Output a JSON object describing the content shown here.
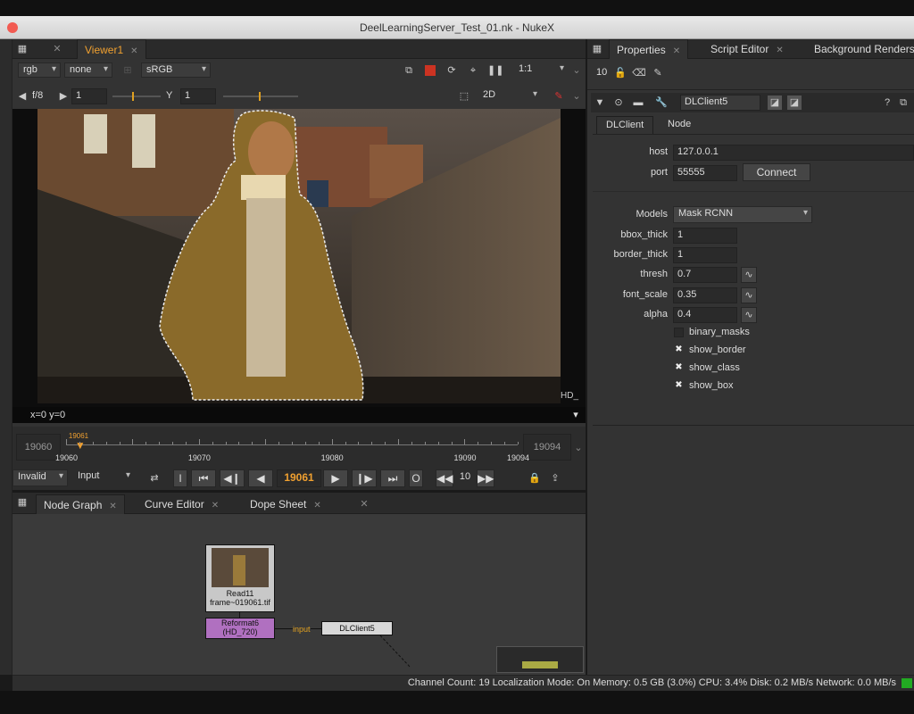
{
  "window": {
    "title": "DeelLearningServer_Test_01.nk - NukeX"
  },
  "viewer": {
    "tab_label": "Viewer1",
    "channels": "rgb",
    "alpha": "none",
    "colorspace": "sRGB",
    "zoom": "1:1",
    "fstop": "f/8",
    "gain": "1",
    "gamma_label": "Y",
    "gamma": "1",
    "mode": "2D",
    "format_label": "HD_",
    "coords": "x=0 y=0"
  },
  "timeline": {
    "start": "19060",
    "end": "19094",
    "current_marker": "19061",
    "ticks": [
      "19060",
      "19070",
      "19080",
      "19090",
      "19094"
    ],
    "cache_mode": "Invalid",
    "input_mode": "Input",
    "current_frame": "19061",
    "step": "10",
    "play_range": {
      "min": 19060,
      "max": 19094,
      "current": 19061
    }
  },
  "bottom_tabs": [
    "Node Graph",
    "Curve Editor",
    "Dope Sheet"
  ],
  "nodes": {
    "read": {
      "name": "Read11",
      "file": "frame~019061.tif"
    },
    "reformat": {
      "name": "Reformat6",
      "format": "(HD_720)"
    },
    "dl": {
      "name": "DLClient5"
    },
    "edge_label": "input"
  },
  "properties": {
    "tabs": [
      "Properties",
      "Script Editor",
      "Background Renders"
    ],
    "max_panels": "10",
    "node_name": "DLClient5",
    "subtabs": [
      "DLClient",
      "Node"
    ],
    "host_label": "host",
    "host": "127.0.0.1",
    "port_label": "port",
    "port": "55555",
    "connect_label": "Connect",
    "models_label": "Models",
    "model": "Mask RCNN",
    "knobs": [
      {
        "label": "bbox_thick",
        "value": "1"
      },
      {
        "label": "border_thick",
        "value": "1"
      },
      {
        "label": "thresh",
        "value": "0.7"
      },
      {
        "label": "font_scale",
        "value": "0.35"
      },
      {
        "label": "alpha",
        "value": "0.4"
      }
    ],
    "checks": [
      {
        "label": "binary_masks",
        "checked": false
      },
      {
        "label": "show_border",
        "checked": true
      },
      {
        "label": "show_class",
        "checked": true
      },
      {
        "label": "show_box",
        "checked": true
      }
    ]
  },
  "status": "Channel Count: 19 Localization Mode: On Memory: 0.5 GB (3.0%) CPU: 3.4% Disk: 0.2 MB/s Network: 0.0 MB/s"
}
